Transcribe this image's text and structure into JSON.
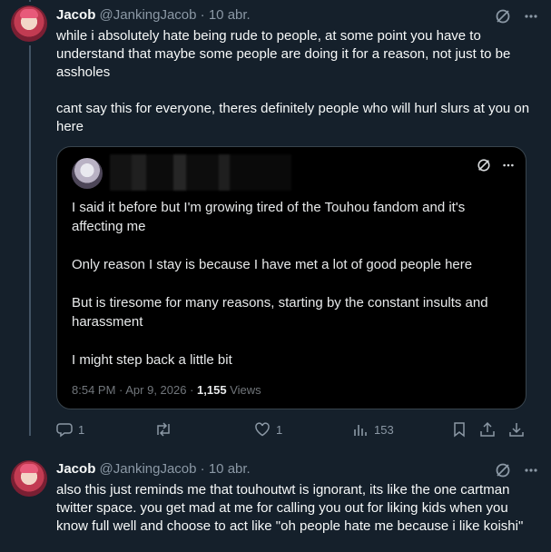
{
  "tweet1": {
    "name": "Jacob",
    "handle": "@JankingJacob",
    "separator": "·",
    "date": "10 abr.",
    "text": "while i absolutely hate being rude to people, at some point you have to understand that maybe some people are doing it for a reason, not just to be assholes\n\ncant say this for everyone, theres definitely people who will hurl slurs at you on here",
    "quote": {
      "text": "I said it before but I'm growing tired of the Touhou fandom and it's affecting me\n\nOnly reason I stay is because I have met a lot of good people here\n\nBut is tiresome for many reasons, starting by the constant insults and harassment\n\nI might step back a little bit",
      "timestamp": "8:54 PM · Apr 9, 2026 · ",
      "views_count": "1,155",
      "views_label": " Views"
    },
    "actions": {
      "replies": "1",
      "retweets": "",
      "likes": "1",
      "views": "153"
    }
  },
  "tweet2": {
    "name": "Jacob",
    "handle": "@JankingJacob",
    "separator": "·",
    "date": "10 abr.",
    "text": "also this just reminds me that touhoutwt is ignorant, its like the one cartman twitter space. you get mad at me for calling you out for liking kids when you know full well and choose to act like \"oh people hate me because i like koishi\""
  },
  "colors": {
    "background": "#15202b",
    "muted": "#8b98a5",
    "border": "#38444d",
    "quote_bg": "#000000"
  },
  "icons": [
    "grok-icon",
    "more-icon",
    "reply-icon",
    "retweet-icon",
    "like-icon",
    "views-icon",
    "bookmark-icon",
    "share-icon",
    "download-icon"
  ]
}
